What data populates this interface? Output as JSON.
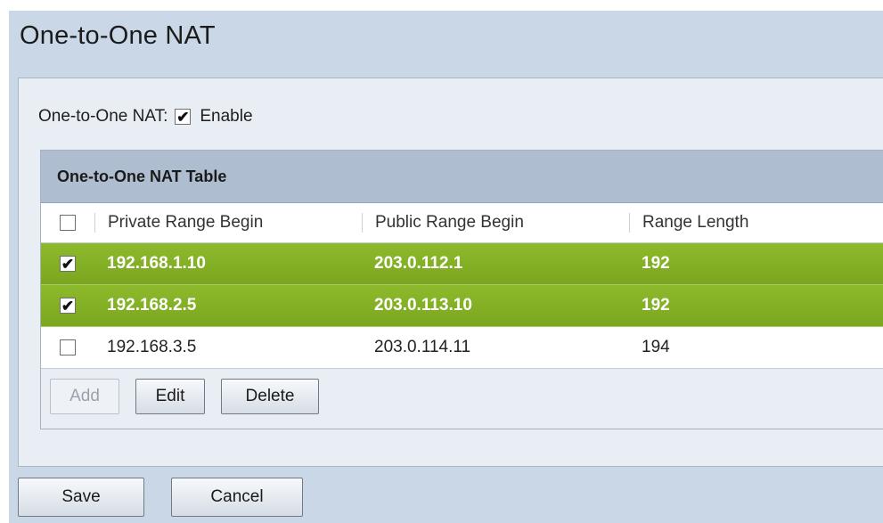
{
  "page": {
    "title": "One-to-One NAT"
  },
  "enable": {
    "label": "One-to-One NAT:",
    "checkbox_label": "Enable",
    "checked": true,
    "check_glyph": "✔"
  },
  "table": {
    "title": "One-to-One NAT Table",
    "columns": [
      "Private Range Begin",
      "Public Range Begin",
      "Range Length"
    ],
    "rows": [
      {
        "checked": true,
        "glyph": "✔",
        "private": "192.168.1.10",
        "public": "203.0.112.1",
        "length": "192"
      },
      {
        "checked": true,
        "glyph": "✔",
        "private": "192.168.2.5",
        "public": "203.0.113.10",
        "length": "192"
      },
      {
        "checked": false,
        "glyph": "",
        "private": "192.168.3.5",
        "public": "203.0.114.11",
        "length": "194"
      }
    ],
    "actions": {
      "add": "Add",
      "edit": "Edit",
      "delete": "Delete"
    }
  },
  "footer": {
    "save": "Save",
    "cancel": "Cancel"
  },
  "colors": {
    "background": "#c9d7e6",
    "panel": "#e9eef5",
    "header": "#aebdd0",
    "selected_row": "#84b026"
  }
}
